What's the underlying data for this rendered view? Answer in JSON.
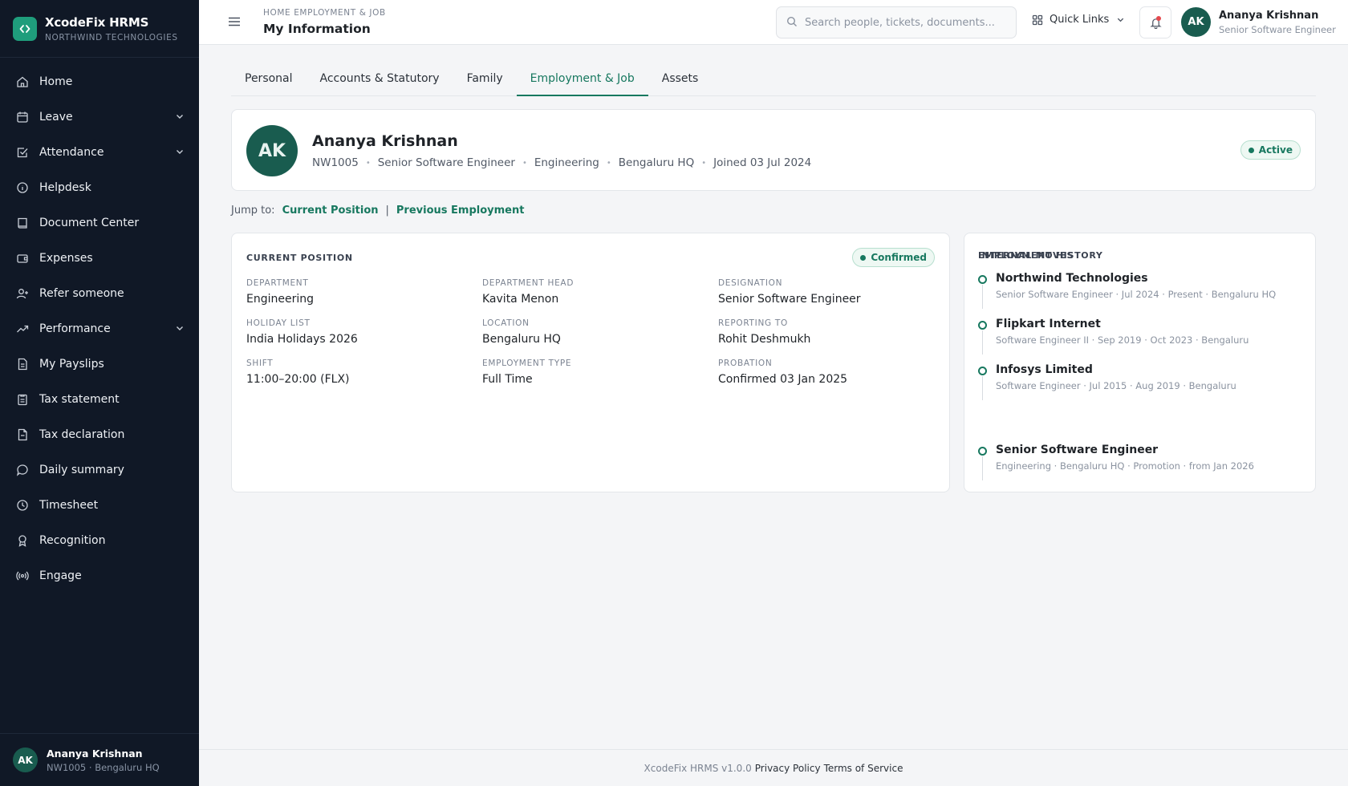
{
  "app": {
    "name": "XcodeFix HRMS",
    "org": "NORTHWIND TECHNOLOGIES",
    "accent": "#17785f",
    "sidebar_bg": "#101826"
  },
  "sidebar": {
    "items": [
      {
        "label": "Home",
        "icon": "home-icon"
      },
      {
        "label": "Leave",
        "icon": "calendar-icon",
        "expandable": true
      },
      {
        "label": "Attendance",
        "icon": "checkbox-icon",
        "expandable": true
      },
      {
        "label": "Helpdesk",
        "icon": "info-icon"
      },
      {
        "label": "Document Center",
        "icon": "book-icon"
      },
      {
        "label": "Expenses",
        "icon": "wallet-icon"
      },
      {
        "label": "Refer someone",
        "icon": "user-plus-icon"
      },
      {
        "label": "Performance",
        "icon": "trending-up-icon",
        "expandable": true
      },
      {
        "label": "My Payslips",
        "icon": "file-icon"
      },
      {
        "label": "Tax statement",
        "icon": "clipboard-icon"
      },
      {
        "label": "Tax declaration",
        "icon": "file-text-icon"
      },
      {
        "label": "Daily summary",
        "icon": "chat-icon"
      },
      {
        "label": "Timesheet",
        "icon": "clock-icon"
      },
      {
        "label": "Recognition",
        "icon": "award-icon"
      },
      {
        "label": "Engage",
        "icon": "broadcast-icon"
      }
    ],
    "user": {
      "initials": "AK",
      "name": "Ananya Krishnan",
      "sub": "NW1005 · Bengaluru HQ"
    }
  },
  "header": {
    "breadcrumb": "HOME EMPLOYMENT & JOB",
    "title": "My Information",
    "search_placeholder": "Search people, tickets, documents...",
    "quick_links": "Quick Links",
    "user": {
      "initials": "AK",
      "name": "Ananya Krishnan",
      "role": "Senior Software Engineer"
    }
  },
  "tabs": [
    "Personal",
    "Accounts & Statutory",
    "Family",
    "Employment & Job",
    "Assets"
  ],
  "active_tab": "Employment & Job",
  "profile": {
    "initials": "AK",
    "name": "Ananya Krishnan",
    "employee_id": "NW1005",
    "designation": "Senior Software Engineer",
    "department": "Engineering",
    "location": "Bengaluru HQ",
    "joined": "Joined 03 Jul 2024",
    "status": "Active"
  },
  "jump": {
    "label": "Jump to:",
    "links": [
      "Current Position",
      "Previous Employment"
    ],
    "separator": "|"
  },
  "current_position": {
    "title": "CURRENT POSITION",
    "status": "Confirmed",
    "fields": [
      {
        "label": "DEPARTMENT",
        "value": "Engineering"
      },
      {
        "label": "DEPARTMENT HEAD",
        "value": "Kavita Menon"
      },
      {
        "label": "DESIGNATION",
        "value": "Senior Software Engineer"
      },
      {
        "label": "HOLIDAY LIST",
        "value": "India Holidays 2026"
      },
      {
        "label": "LOCATION",
        "value": "Bengaluru HQ"
      },
      {
        "label": "REPORTING TO",
        "value": "Rohit Deshmukh"
      },
      {
        "label": "SHIFT",
        "value": "11:00–20:00 (FLX)"
      },
      {
        "label": "EMPLOYMENT TYPE",
        "value": "Full Time"
      },
      {
        "label": "PROBATION",
        "value": "Confirmed 03 Jan 2025"
      }
    ]
  },
  "history": {
    "title": "EMPLOYMENT HISTORY",
    "items": [
      {
        "company": "Northwind Technologies",
        "detail": "Senior Software Engineer · Jul 2024 · Present · Bengaluru HQ"
      },
      {
        "company": "Flipkart Internet",
        "detail": "Software Engineer II · Sep 2019 · Oct 2023 · Bengaluru"
      },
      {
        "company": "Infosys Limited",
        "detail": "Software Engineer · Jul 2015 · Aug 2019 · Bengaluru"
      }
    ],
    "internal_title": "INTERNAL MOVES",
    "internal_items": [
      {
        "company": "Senior Software Engineer",
        "detail": "Engineering · Bengaluru HQ · Promotion · from Jan 2026"
      }
    ]
  },
  "footer": {
    "version": "XcodeFix HRMS v1.0.0",
    "privacy": "Privacy Policy",
    "terms": "Terms of Service"
  }
}
